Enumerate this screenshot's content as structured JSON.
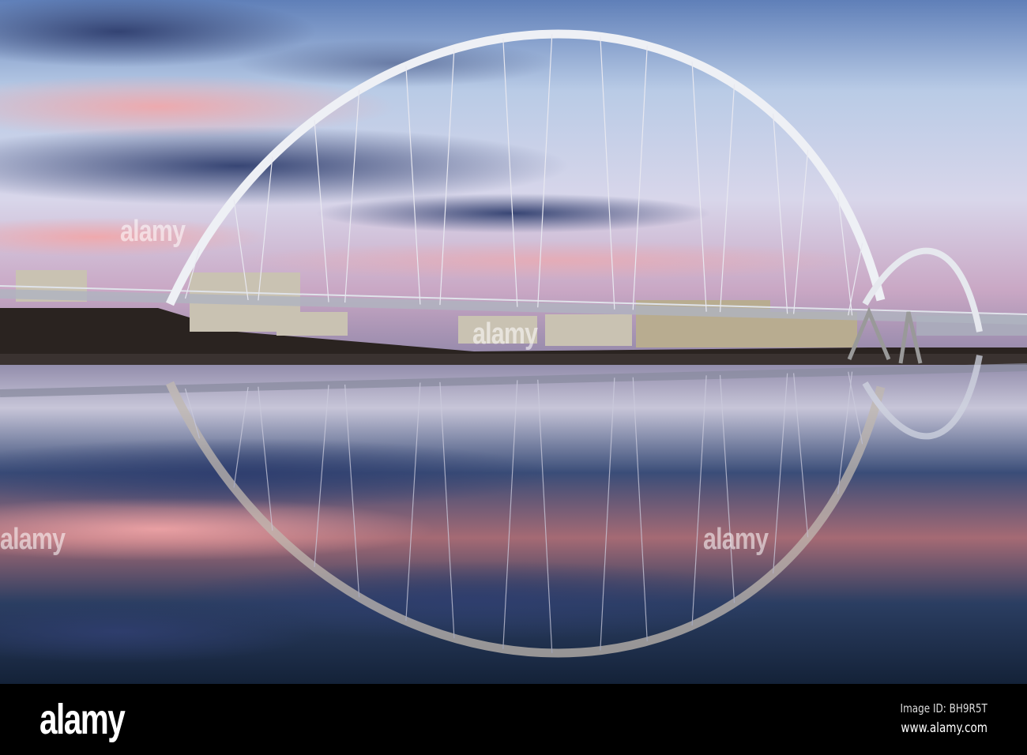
{
  "watermark": {
    "text": "alamy"
  },
  "footer": {
    "logo": "alamy",
    "image_id": "Image ID: BH9R5T",
    "url": "www.alamy.com"
  }
}
